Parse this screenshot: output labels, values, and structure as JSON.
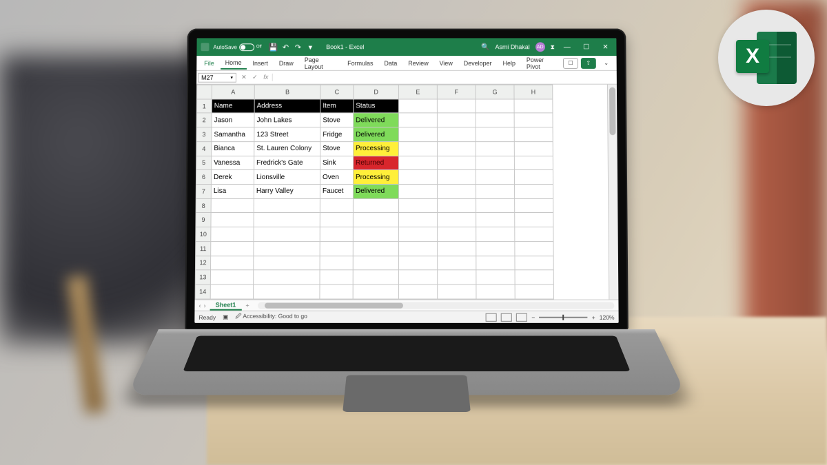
{
  "titlebar": {
    "autosave_label": "AutoSave",
    "autosave_state": "Off",
    "doc": "Book1 - Excel",
    "user": "Asmi Dhakal",
    "user_initials": "AD"
  },
  "ribbon": {
    "tabs": [
      "File",
      "Home",
      "Insert",
      "Draw",
      "Page Layout",
      "Formulas",
      "Data",
      "Review",
      "View",
      "Developer",
      "Help",
      "Power Pivot"
    ]
  },
  "formula_bar": {
    "name_box": "M27",
    "fx_label": "fx",
    "formula": ""
  },
  "columns": [
    "A",
    "B",
    "C",
    "D",
    "E",
    "F",
    "G",
    "H"
  ],
  "row_count": 14,
  "headers": {
    "A": "Name",
    "B": "Address",
    "C": "Item",
    "D": "Status"
  },
  "rows": [
    {
      "name": "Jason",
      "address": "John Lakes",
      "item": "Stove",
      "status": "Delivered",
      "status_class": "st-green"
    },
    {
      "name": "Samantha",
      "address": "123 Street",
      "item": "Fridge",
      "status": "Delivered",
      "status_class": "st-green"
    },
    {
      "name": "Bianca",
      "address": "St. Lauren Colony",
      "item": "Stove",
      "status": "Processing",
      "status_class": "st-yellow"
    },
    {
      "name": "Vanessa",
      "address": "Fredrick's Gate",
      "item": "Sink",
      "status": "Returned",
      "status_class": "st-red"
    },
    {
      "name": "Derek",
      "address": "Lionsville",
      "item": "Oven",
      "status": "Processing",
      "status_class": "st-yellow"
    },
    {
      "name": "Lisa",
      "address": "Harry Valley",
      "item": "Faucet",
      "status": "Delivered",
      "status_class": "st-green"
    }
  ],
  "sheet": {
    "active": "Sheet1"
  },
  "status": {
    "ready": "Ready",
    "accessibility": "Accessibility: Good to go",
    "zoom": "120%"
  }
}
